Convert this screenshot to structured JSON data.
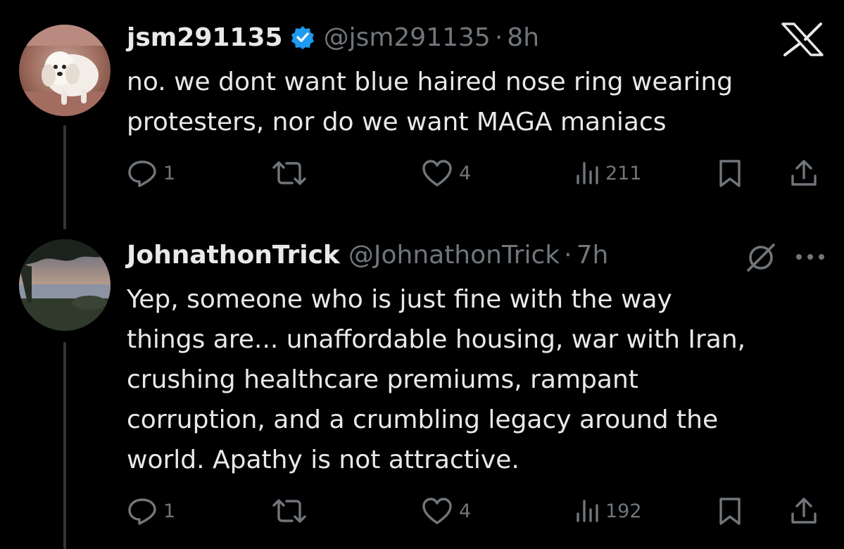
{
  "tweets": [
    {
      "display_name": "jsm291135",
      "handle": "@jsm291135",
      "separator": "·",
      "time": "8h",
      "verified": true,
      "avatar": "avatar-dog-photo",
      "lines": [
        "no. we dont want blue haired nose ring wearing",
        "protesters, nor do we want MAGA maniacs"
      ],
      "replies": "1",
      "reposts": "",
      "likes": "4",
      "views": "211"
    },
    {
      "display_name": "JohnathonTrick",
      "handle": "@JohnathonTrick",
      "separator": "·",
      "time": "7h",
      "verified": false,
      "avatar": "avatar-lake-sunset-photo",
      "lines": [
        "Yep, someone who is just fine with the way",
        "things are... unaffordable housing, war with Iran,",
        "crushing healthcare premiums, rampant",
        "corruption, and a crumbling legacy around the",
        "world. Apathy is not attractive."
      ],
      "replies": "1",
      "reposts": "",
      "likes": "4",
      "views": "192"
    }
  ],
  "icons": {
    "close": "x-logo-icon",
    "grok": "grok-icon",
    "more": "more-options-icon",
    "reply": "reply-icon",
    "repost": "repost-icon",
    "like": "heart-icon",
    "views": "views-icon",
    "bookmark": "bookmark-icon",
    "share": "share-icon"
  },
  "colors": {
    "background": "#000000",
    "text": "#e7e9ea",
    "secondary": "#71767b",
    "verified": "#1d9bf0",
    "thread_line": "#333639"
  }
}
